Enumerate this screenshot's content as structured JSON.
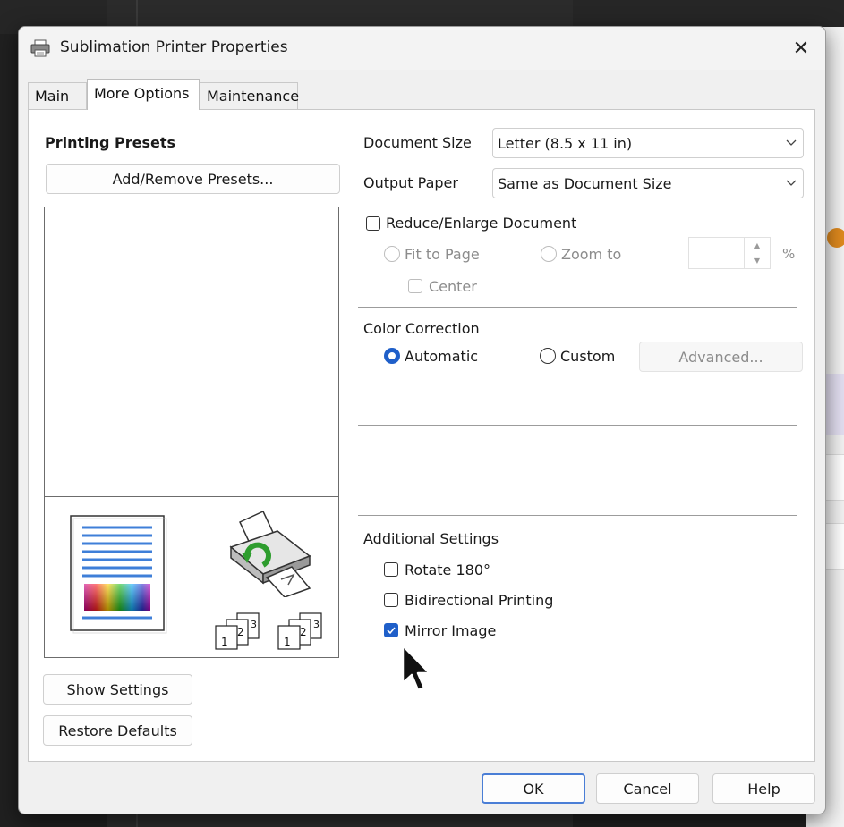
{
  "dialog": {
    "title": "Sublimation Printer Properties",
    "close_glyph": "✕"
  },
  "tabs": [
    {
      "label": "Main"
    },
    {
      "label": "More Options"
    },
    {
      "label": "Maintenance"
    }
  ],
  "active_tab": "More Options",
  "presets": {
    "heading": "Printing Presets",
    "add_remove_label": "Add/Remove Presets..."
  },
  "document_size": {
    "label": "Document Size",
    "value": "Letter (8.5 x 11 in)"
  },
  "output_paper": {
    "label": "Output Paper",
    "value": "Same as Document Size"
  },
  "reduce_enlarge": {
    "label": "Reduce/Enlarge Document",
    "checked": false,
    "fit_to_page_label": "Fit to Page",
    "zoom_to_label": "Zoom to",
    "zoom_value": "",
    "percent_label": "%",
    "center_label": "Center"
  },
  "color_correction": {
    "heading": "Color Correction",
    "automatic_label": "Automatic",
    "custom_label": "Custom",
    "selected": "Automatic",
    "advanced_label": "Advanced..."
  },
  "additional_settings": {
    "heading": "Additional Settings",
    "rotate_label": "Rotate 180°",
    "rotate_checked": false,
    "bidirectional_label": "Bidirectional Printing",
    "bidirectional_checked": false,
    "mirror_label": "Mirror Image",
    "mirror_checked": true
  },
  "preview_icons": {
    "page_icon": "page-preview-icon",
    "printer_icon": "printer-rotate-icon",
    "collate_icon_1": "collate-pages-icon",
    "collate_icon_2": "collate-pages-icon",
    "collate_numbers": [
      "1",
      "2",
      "3"
    ]
  },
  "left_buttons": {
    "show_settings": "Show Settings",
    "restore_defaults": "Restore Defaults"
  },
  "footer": {
    "ok": "OK",
    "cancel": "Cancel",
    "help": "Help"
  },
  "colors": {
    "accent": "#1f5fc9",
    "default_button_border": "#4a7ed6",
    "preview_lines": "#3f7fd8"
  }
}
